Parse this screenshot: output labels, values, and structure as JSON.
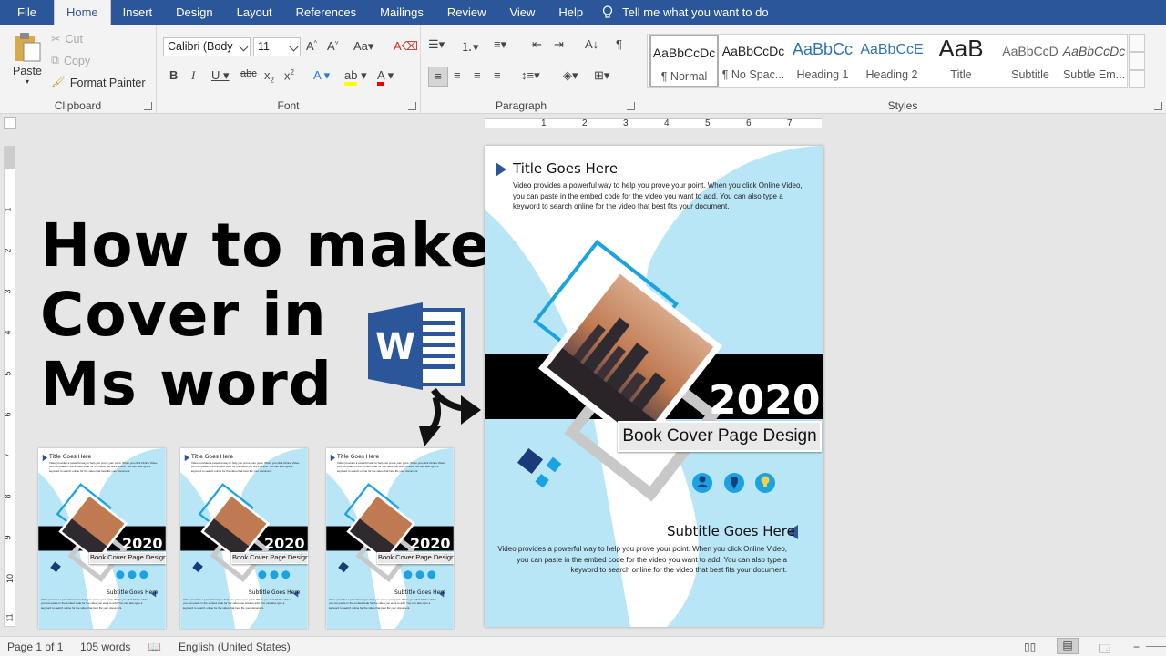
{
  "menu": {
    "tabs": [
      "File",
      "Home",
      "Insert",
      "Design",
      "Layout",
      "References",
      "Mailings",
      "Review",
      "View",
      "Help"
    ],
    "active_tab": "Home",
    "tell_me": "Tell me what you want to do"
  },
  "ribbon": {
    "clipboard": {
      "paste": "Paste",
      "cut": "Cut",
      "copy": "Copy",
      "format_painter": "Format Painter",
      "label": "Clipboard"
    },
    "font": {
      "name": "Calibri (Body",
      "size": "11",
      "label": "Font"
    },
    "paragraph": {
      "label": "Paragraph"
    },
    "styles": {
      "label": "Styles",
      "items": [
        {
          "preview": "AaBbCcDc",
          "name": "¶ Normal"
        },
        {
          "preview": "AaBbCcDc",
          "name": "¶ No Spac..."
        },
        {
          "preview": "AaBbCc",
          "name": "Heading 1"
        },
        {
          "preview": "AaBbCcE",
          "name": "Heading 2"
        },
        {
          "preview": "AaB",
          "name": "Title"
        },
        {
          "preview": "AaBbCcD",
          "name": "Subtitle"
        },
        {
          "preview": "AaBbCcDc",
          "name": "Subtle Em..."
        }
      ]
    }
  },
  "ruler": {
    "h_numbers": [
      "1",
      "2",
      "3",
      "4",
      "5",
      "6",
      "7"
    ],
    "v_numbers": [
      "1",
      "2",
      "3",
      "4",
      "5",
      "6",
      "7",
      "8",
      "9",
      "10",
      "11"
    ]
  },
  "headline": {
    "line1": "How to make",
    "line2": "Cover in",
    "line3": "Ms word"
  },
  "logo": {
    "letter": "W"
  },
  "cover": {
    "title": "Title Goes Here",
    "intro": "Video provides a powerful way to help you prove your point. When you click Online Video, you can paste in the embed code for the video you want to add. You can also type a keyword to search online for the video that best fits your document.",
    "year": "2020",
    "book_label": "Book Cover Page Design",
    "subtitle": "Subtitle Goes Here",
    "body": "Video provides a powerful way to help you prove your point. When you click Online Video, you can paste in the embed code for the video you want to add. You can also type a keyword to search online for the video that best fits your document."
  },
  "status": {
    "page": "Page 1 of 1",
    "words": "105 words",
    "language": "English (United States)"
  },
  "colors": {
    "accent": "#2b579a",
    "light_blue": "#b9e6f7",
    "dark_navy": "#1a3a7a",
    "cyan": "#1aa3e0"
  }
}
